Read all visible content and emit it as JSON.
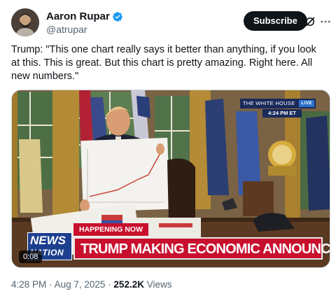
{
  "author": {
    "display_name": "Aaron Rupar",
    "handle": "@atrupar",
    "verified": true,
    "avatar_icon": "profile-photo"
  },
  "actions": {
    "subscribe_label": "Subscribe",
    "grok_icon": "grok-icon",
    "more_icon": "more-icon"
  },
  "tweet": {
    "text": "Trump: \"This one chart really says it better than anything, if you look at this. This is great. But this chart is pretty amazing. Right here. All new numbers.\""
  },
  "video": {
    "source_banner": "THE WHITE HOUSE",
    "live_badge": "LIVE",
    "clock": "4:24 PM ET",
    "happening_now": "HAPPENING NOW",
    "headline": "TRUMP MAKING ECONOMIC ANNOUNCEMENT",
    "network_logo_top": "NEWS",
    "network_logo_bottom": "NATION",
    "duration": "0:08",
    "colors": {
      "banner_red": "#c8102e",
      "logo_blue": "#1d3f8f",
      "wh_navy": "#1a2a5a"
    }
  },
  "meta": {
    "time": "4:28 PM",
    "separator": "·",
    "date": "Aug 7, 2025",
    "views_count": "252.2K",
    "views_label": "Views"
  }
}
